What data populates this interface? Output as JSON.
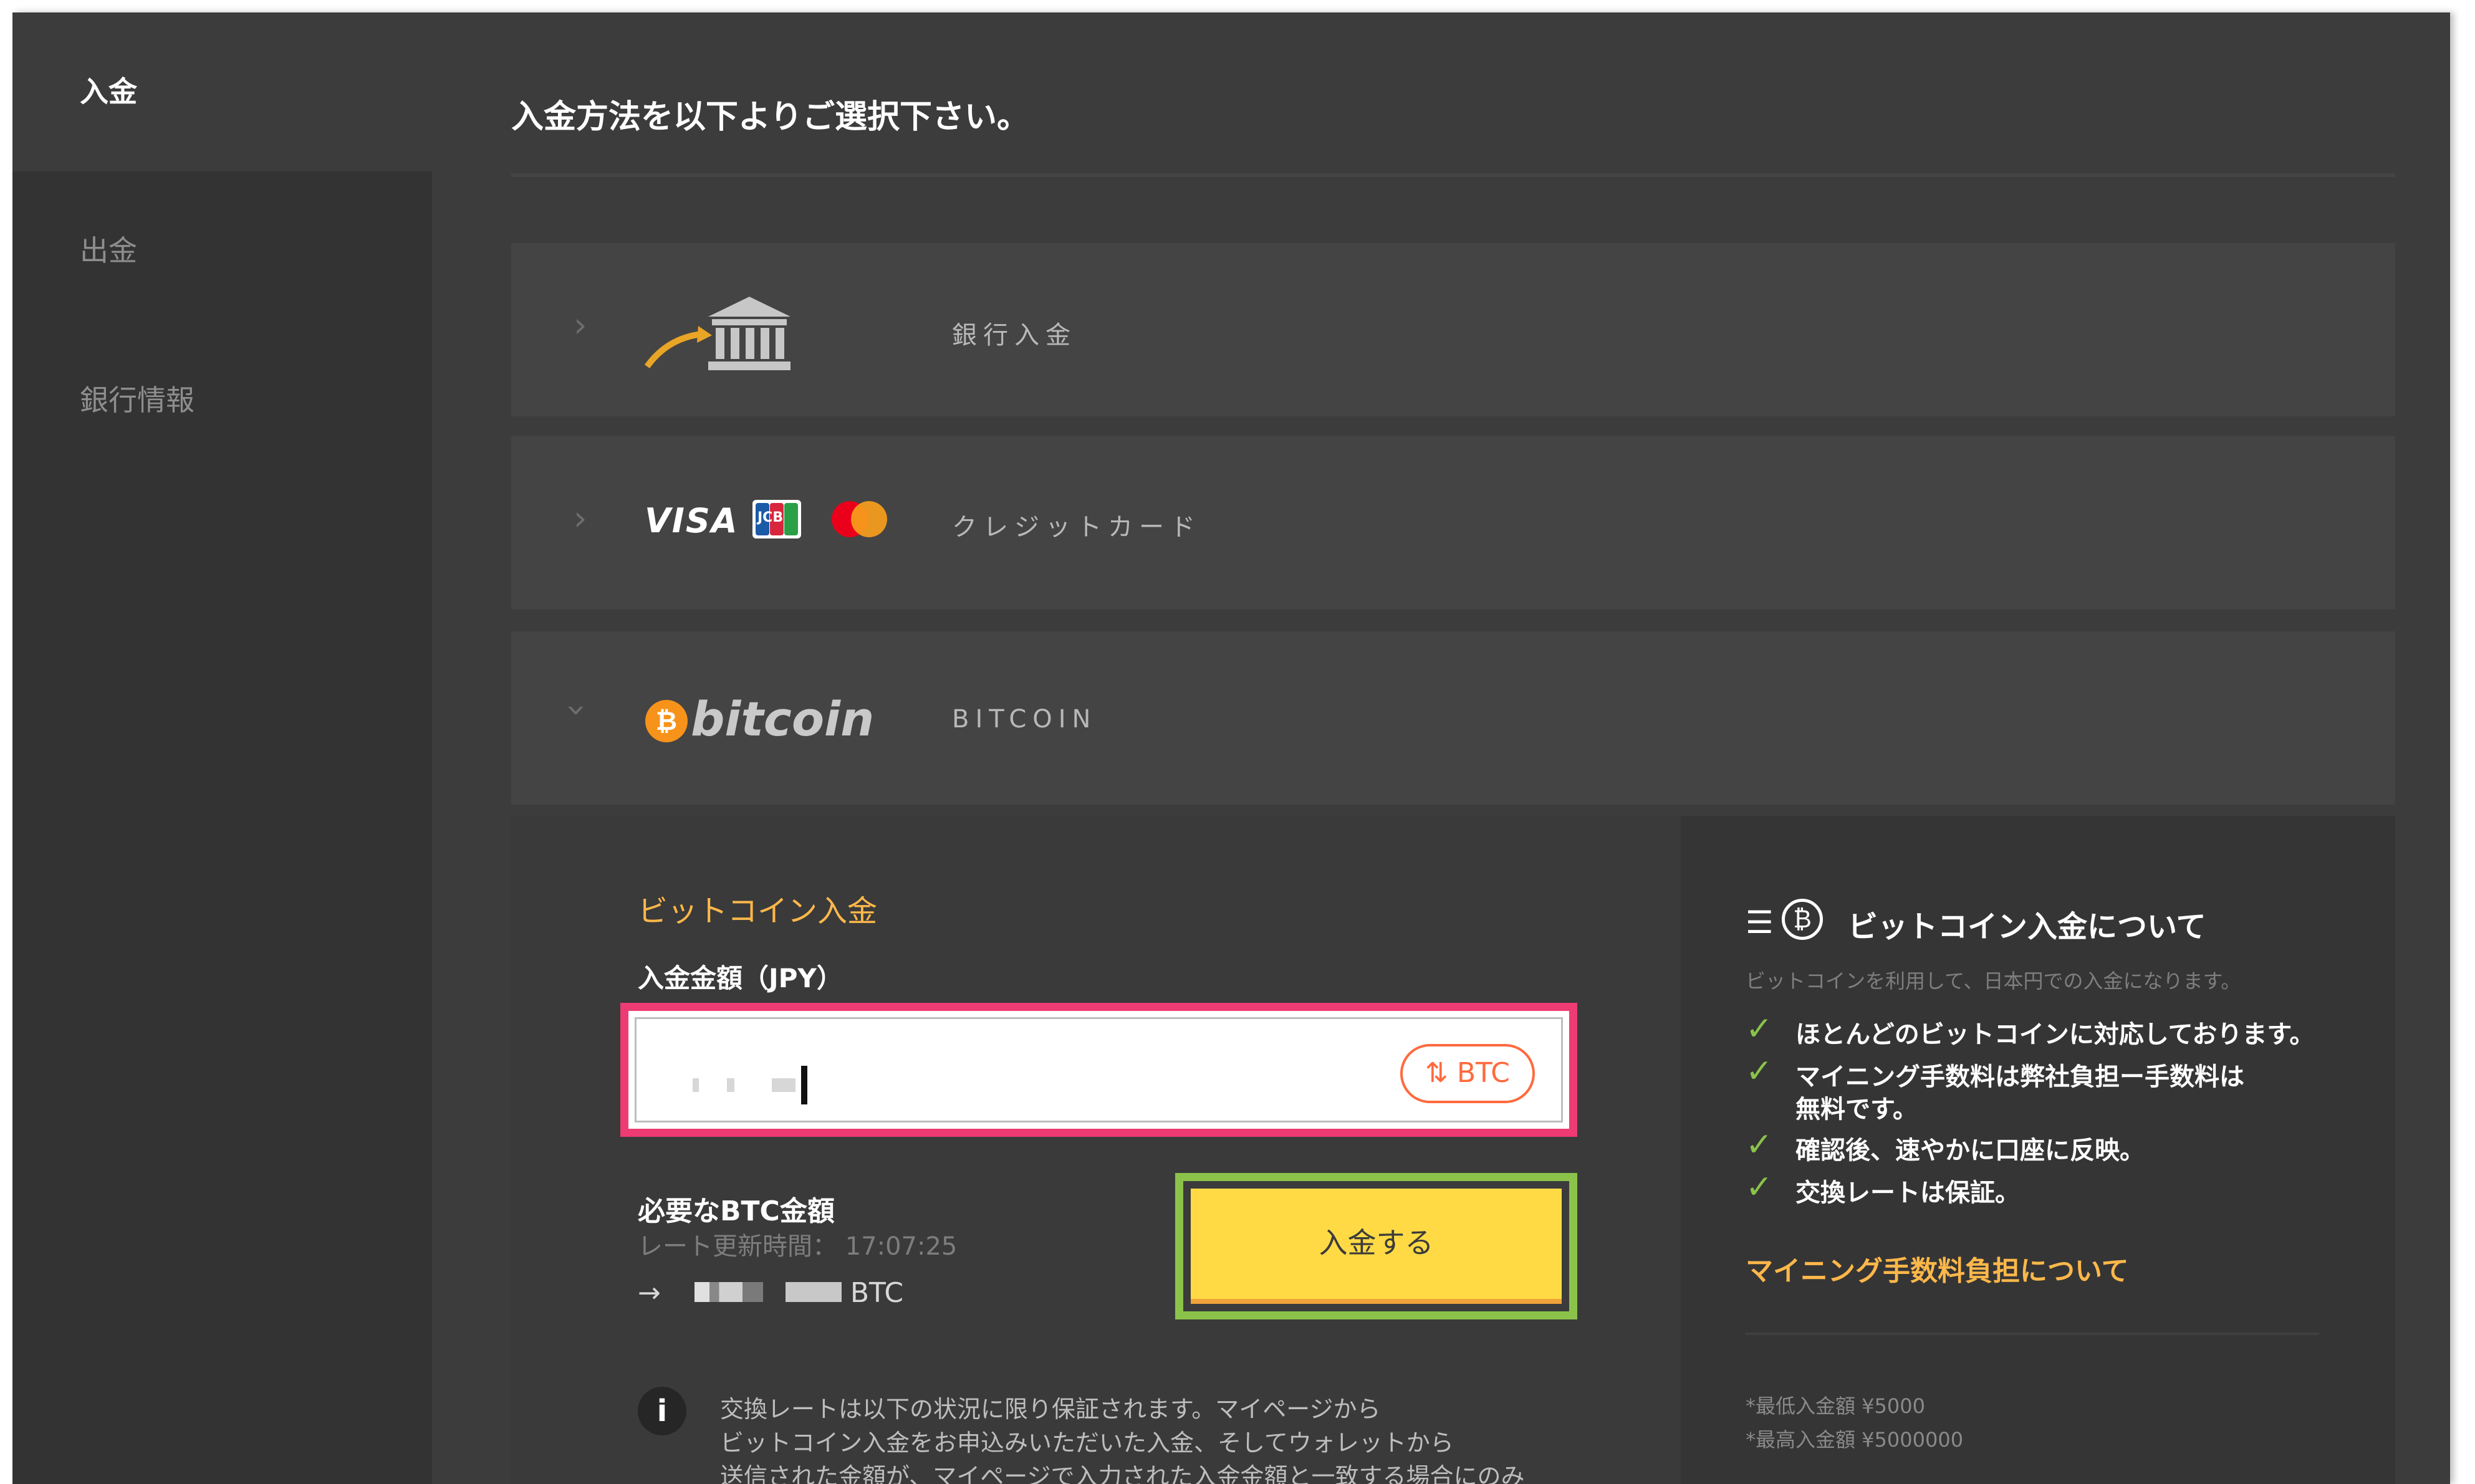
{
  "sidebar": {
    "items": [
      {
        "label": "入金",
        "active": true
      },
      {
        "label": "出金",
        "active": false
      },
      {
        "label": "銀行情報",
        "active": false
      }
    ]
  },
  "main": {
    "title": "入金方法を以下よりご選択下さい。",
    "methods": [
      {
        "label": "銀行入金",
        "icon": "bank-icon"
      },
      {
        "label": "クレジットカード",
        "icons": [
          "visa-logo",
          "jcb-logo",
          "mastercard-logo"
        ],
        "visa": "VISA",
        "jcb": "JCB"
      },
      {
        "label": "BITCOIN",
        "logo_text": "bitcoin"
      }
    ]
  },
  "bitcoin_form": {
    "heading": "ビットコイン入金",
    "amount_label": "入金金額（JPY）",
    "toggle_label": "BTC",
    "required_label": "必要なBTC金額",
    "rate_time_label": "レート更新時間：",
    "rate_time": "17:07:25",
    "btc_suffix": "BTC",
    "deposit_button": "入金する",
    "note_lines": [
      "交換レートは以下の状況に限り保証されます。マイページから",
      "ビットコイン入金をお申込みいただいた入金、そしてウォレットから",
      "送信された金額が、マイページで入力された入金金額と一致する場合にのみ"
    ]
  },
  "about": {
    "title": "ビットコイン入金について",
    "desc": "ビットコインを利用して、日本円での入金になります。",
    "points": [
      "ほとんどのビットコインに対応しております。",
      "マイニング手数料は弊社負担ー手数料は",
      "無料です。",
      "確認後、速やかに口座に反映。",
      "交換レートは保証。"
    ],
    "link": "マイニング手数料負担について",
    "min_amount": "*最低入金額 ¥5000",
    "max_amount": "*最高入金額 ¥5000000"
  },
  "colors": {
    "accent_yellow": "#ffda45",
    "accent_orange": "#ffb84a",
    "highlight_pink": "#ee3b73",
    "highlight_green": "#8bc34a"
  }
}
